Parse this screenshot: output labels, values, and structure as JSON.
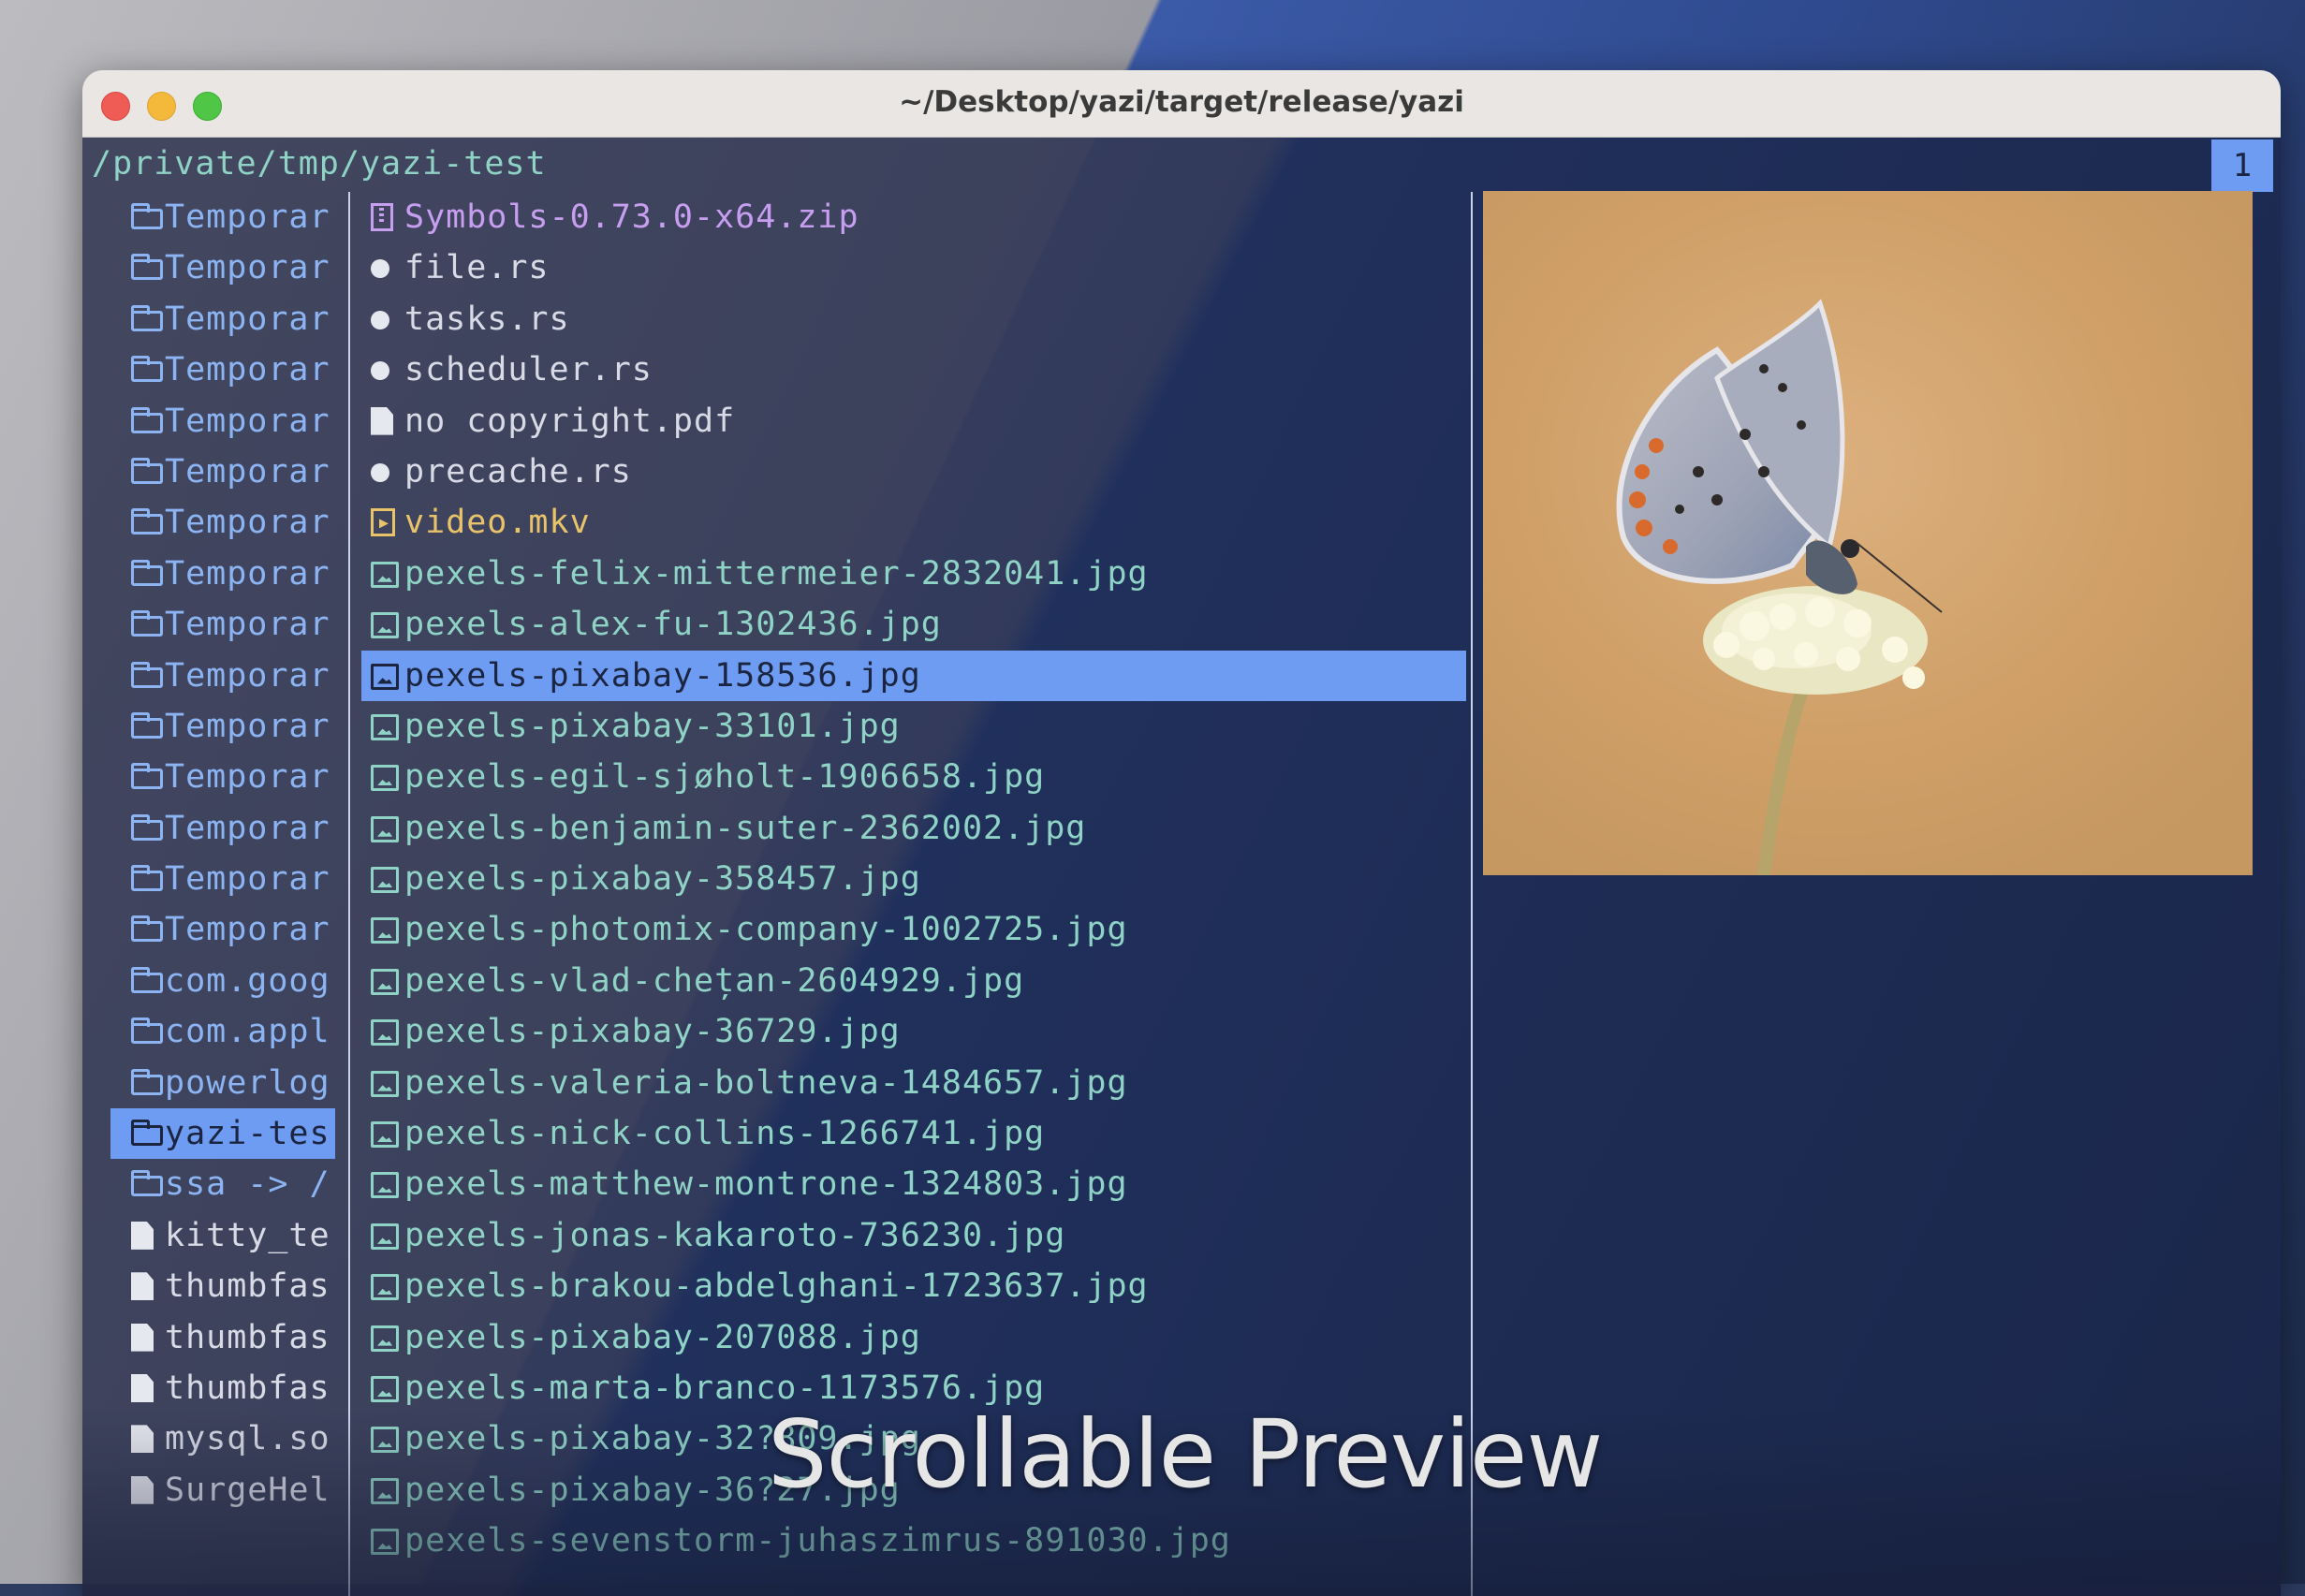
{
  "window": {
    "title": "~/Desktop/yazi/target/release/yazi"
  },
  "terminal": {
    "path": "/private/tmp/yazi-test",
    "tab_number": "1"
  },
  "parent_items": [
    {
      "label": "Temporar",
      "kind": "dir"
    },
    {
      "label": "Temporar",
      "kind": "dir"
    },
    {
      "label": "Temporar",
      "kind": "dir"
    },
    {
      "label": "Temporar",
      "kind": "dir"
    },
    {
      "label": "Temporar",
      "kind": "dir"
    },
    {
      "label": "Temporar",
      "kind": "dir"
    },
    {
      "label": "Temporar",
      "kind": "dir"
    },
    {
      "label": "Temporar",
      "kind": "dir"
    },
    {
      "label": "Temporar",
      "kind": "dir"
    },
    {
      "label": "Temporar",
      "kind": "dir"
    },
    {
      "label": "Temporar",
      "kind": "dir"
    },
    {
      "label": "Temporar",
      "kind": "dir"
    },
    {
      "label": "Temporar",
      "kind": "dir"
    },
    {
      "label": "Temporar",
      "kind": "dir"
    },
    {
      "label": "Temporar",
      "kind": "dir"
    },
    {
      "label": "com.goog",
      "kind": "dir"
    },
    {
      "label": "com.appl",
      "kind": "dir"
    },
    {
      "label": "powerlog",
      "kind": "dir"
    },
    {
      "label": "yazi-tes",
      "kind": "dir",
      "selected": true
    },
    {
      "label": "ssa -> /",
      "kind": "dir"
    },
    {
      "label": "kitty_te",
      "kind": "file"
    },
    {
      "label": "thumbfas",
      "kind": "file"
    },
    {
      "label": "thumbfas",
      "kind": "file"
    },
    {
      "label": "thumbfas",
      "kind": "file"
    },
    {
      "label": "mysql.so",
      "kind": "file"
    },
    {
      "label": "SurgeHel",
      "kind": "file"
    }
  ],
  "current_items": [
    {
      "label": "Symbols-0.73.0-x64.zip",
      "kind": "zip"
    },
    {
      "label": "file.rs",
      "kind": "rs"
    },
    {
      "label": "tasks.rs",
      "kind": "rs"
    },
    {
      "label": "scheduler.rs",
      "kind": "rs"
    },
    {
      "label": "no copyright.pdf",
      "kind": "file"
    },
    {
      "label": "precache.rs",
      "kind": "rs"
    },
    {
      "label": "video.mkv",
      "kind": "vid"
    },
    {
      "label": "pexels-felix-mittermeier-2832041.jpg",
      "kind": "img"
    },
    {
      "label": "pexels-alex-fu-1302436.jpg",
      "kind": "img"
    },
    {
      "label": "pexels-pixabay-158536.jpg",
      "kind": "img",
      "selected": true
    },
    {
      "label": "pexels-pixabay-33101.jpg",
      "kind": "img"
    },
    {
      "label": "pexels-egil-sjøholt-1906658.jpg",
      "kind": "img"
    },
    {
      "label": "pexels-benjamin-suter-2362002.jpg",
      "kind": "img"
    },
    {
      "label": "pexels-pixabay-358457.jpg",
      "kind": "img"
    },
    {
      "label": "pexels-photomix-company-1002725.jpg",
      "kind": "img"
    },
    {
      "label": "pexels-vlad-chețan-2604929.jpg",
      "kind": "img"
    },
    {
      "label": "pexels-pixabay-36729.jpg",
      "kind": "img"
    },
    {
      "label": "pexels-valeria-boltneva-1484657.jpg",
      "kind": "img"
    },
    {
      "label": "pexels-nick-collins-1266741.jpg",
      "kind": "img"
    },
    {
      "label": "pexels-matthew-montrone-1324803.jpg",
      "kind": "img"
    },
    {
      "label": "pexels-jonas-kakaroto-736230.jpg",
      "kind": "img"
    },
    {
      "label": "pexels-brakou-abdelghani-1723637.jpg",
      "kind": "img"
    },
    {
      "label": "pexels-pixabay-207088.jpg",
      "kind": "img"
    },
    {
      "label": "pexels-marta-branco-1173576.jpg",
      "kind": "img"
    },
    {
      "label": "pexels-pixabay-32?809.jpg",
      "kind": "img"
    },
    {
      "label": "pexels-pixabay-36?27.jpg",
      "kind": "img"
    },
    {
      "label": "pexels-sevenstorm-juhaszimrus-891030.jpg",
      "kind": "img"
    }
  ],
  "caption": "Scrollable Preview",
  "colors": {
    "selection": "#6e9cf3",
    "directory": "#8cb4f3",
    "image": "#8fd3c6",
    "archive": "#c79ef0",
    "video": "#e8c36a"
  }
}
